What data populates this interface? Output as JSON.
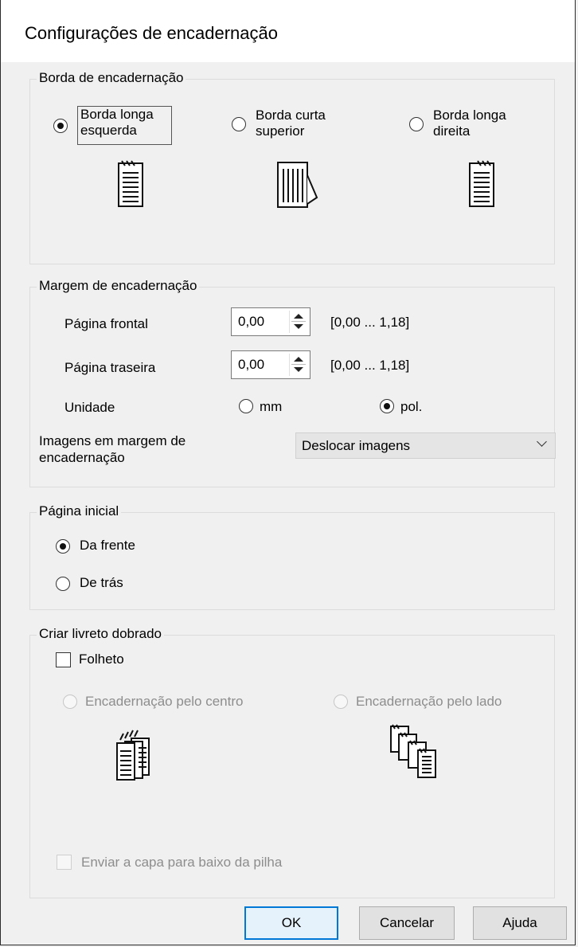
{
  "title": "Configurações de encadernação",
  "binding_edge": {
    "legend": "Borda de encadernação",
    "options": [
      {
        "line1": "Borda longa",
        "line2": "esquerda",
        "selected": true,
        "icon": "left-bound-page-icon"
      },
      {
        "line1": "Borda curta",
        "line2": "superior",
        "selected": false,
        "icon": "top-bound-page-icon"
      },
      {
        "line1": "Borda longa",
        "line2": "direita",
        "selected": false,
        "icon": "right-bound-page-icon"
      }
    ]
  },
  "binding_margin": {
    "legend": "Margem de encadernação",
    "front_label": "Página frontal",
    "front_value": "0,00",
    "front_range": "[0,00 ... 1,18]",
    "back_label": "Página traseira",
    "back_value": "0,00",
    "back_range": "[0,00 ... 1,18]",
    "unit_label": "Unidade",
    "unit_mm": "mm",
    "unit_in": "pol.",
    "unit_selected": "pol.",
    "images_label_line1": "Imagens em margem de",
    "images_label_line2": "encadernação",
    "images_value": "Deslocar imagens"
  },
  "start_page": {
    "legend": "Página inicial",
    "front": "Da frente",
    "back": "De trás",
    "selected": "Da frente"
  },
  "booklet": {
    "legend": "Criar livreto dobrado",
    "folheto_label": "Folheto",
    "folheto_checked": false,
    "center_label": "Encadernação pelo centro",
    "side_label": "Encadernação pelo lado",
    "cover_label": "Enviar a capa para baixo da pilha"
  },
  "buttons": {
    "ok": "OK",
    "cancel": "Cancelar",
    "help": "Ajuda"
  },
  "colors": {
    "default_button_border": "#0078d7",
    "disabled_text": "#8d8d8d"
  }
}
